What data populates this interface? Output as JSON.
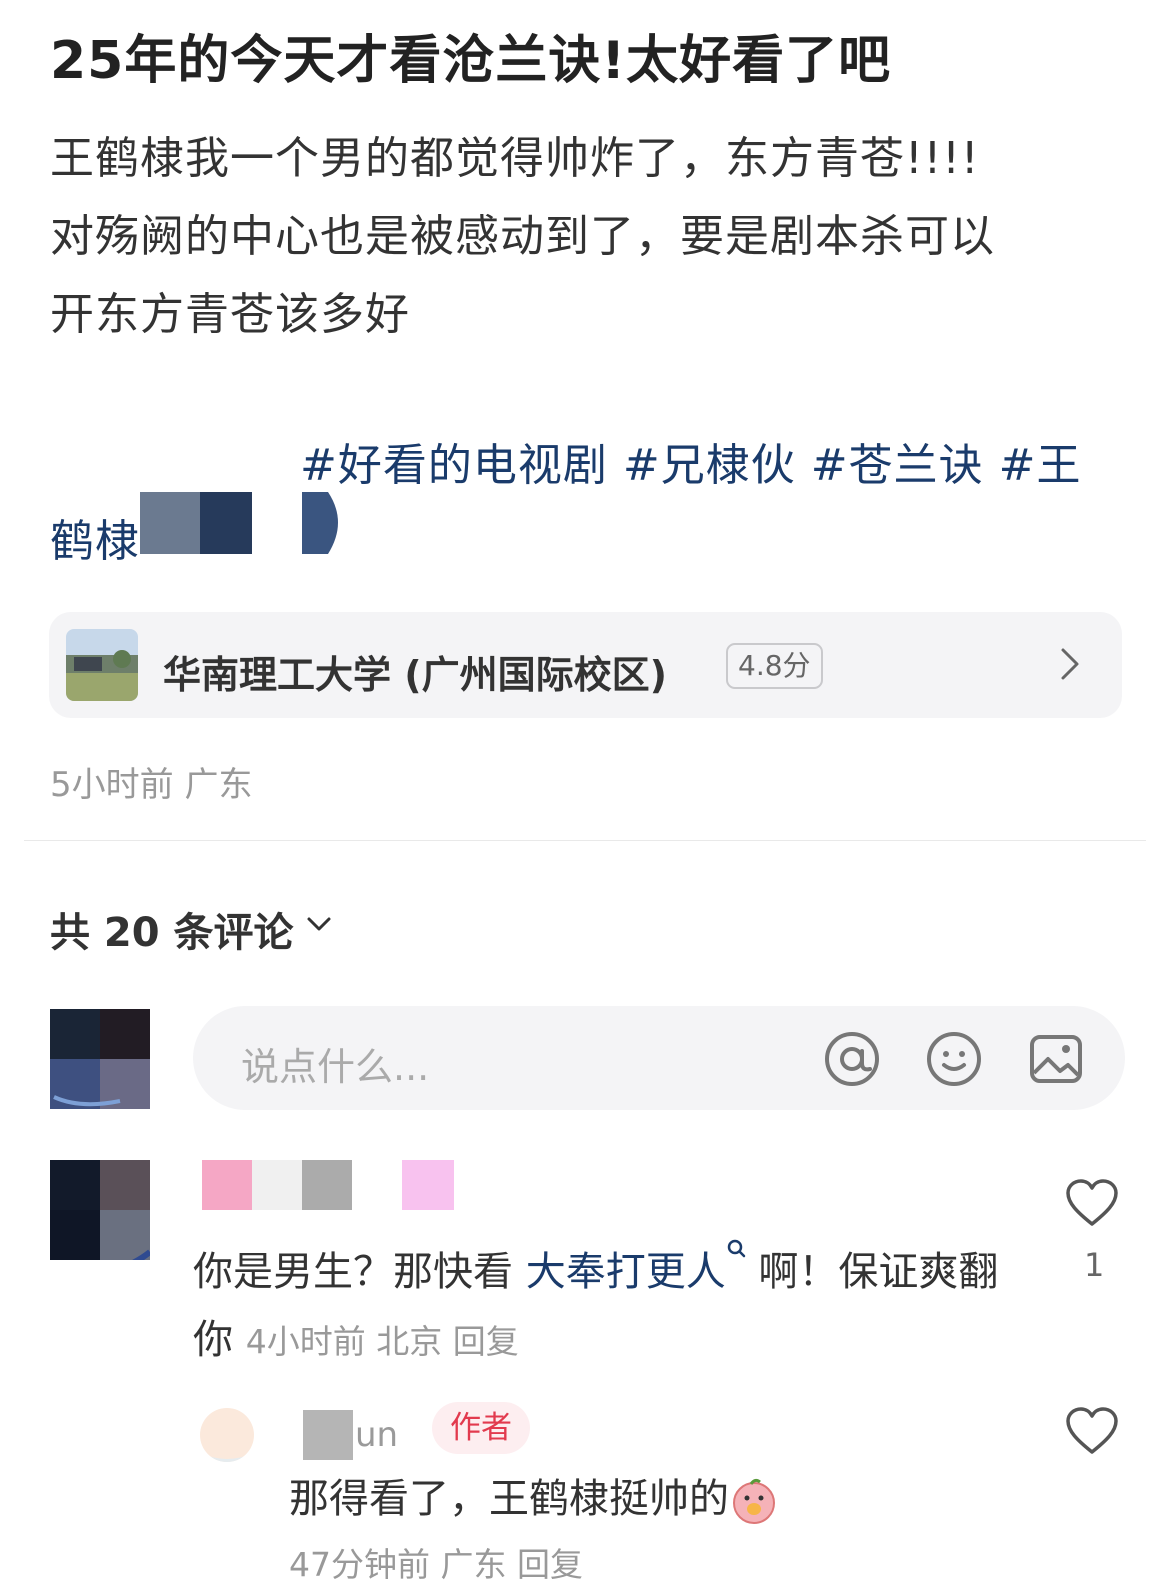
{
  "post": {
    "title": "25年的今天才看沧兰诀!太好看了吧",
    "body_lines": [
      "王鹤棣我一个男的都觉得帅炸了，东方青苍!!!!",
      "对殇阙的中心也是被感动到了，要是剧本杀可以",
      "开东方青苍该多好"
    ],
    "tags": [
      "#好看的电视剧",
      "#兄棣伙",
      "#苍兰诀",
      "#王鹤棣"
    ],
    "location_card": {
      "name": "华南理工大学 (广州国际校区)",
      "score": "4.8分",
      "chevron_icon": "chevron-right-icon"
    },
    "meta": "5小时前 广东"
  },
  "comments_section": {
    "count_label": "共 20 条评论",
    "count_chevron_icon": "chevron-down-icon",
    "input": {
      "placeholder": "说点什么...",
      "icons": [
        "at-icon",
        "emoji-icon",
        "image-icon"
      ]
    },
    "comments": [
      {
        "text": "你是男生？那快看 ",
        "link_text": "大奉打更人",
        "link_icon": "search-icon",
        "text_after": " 啊！保证爽翻你",
        "meta": "4小时前 北京 回复",
        "likes": "1",
        "like_icon": "heart-icon"
      }
    ],
    "reply": {
      "name_partial": "un",
      "badge": "作者",
      "text": "那得看了，王鹤棣挺帅的",
      "emoji_icon": "peach-emoji-icon",
      "meta": "47分钟前 广东 回复",
      "like_icon": "heart-icon"
    }
  },
  "colors": {
    "tag_blue": "#1a3b6b",
    "author_badge_red": "#e23a4e",
    "card_bg": "#f4f4f6",
    "meta_gray": "#999999"
  }
}
